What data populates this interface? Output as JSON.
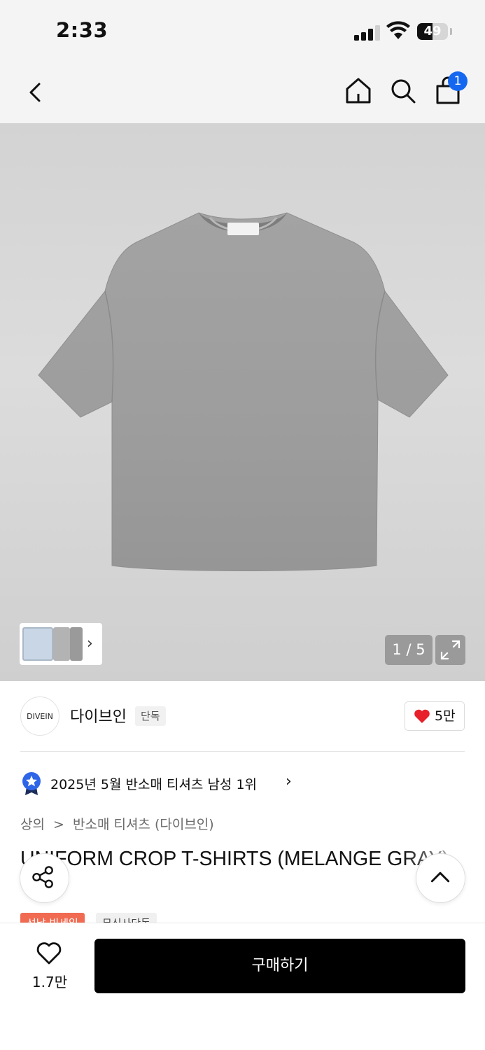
{
  "status_bar": {
    "time": "2:33",
    "battery_level": "49"
  },
  "nav": {
    "cart_count": "1"
  },
  "gallery": {
    "counter": "1 / 5",
    "current_index": 1,
    "total_images": 5,
    "product_color": "#9c9c9c"
  },
  "brand": {
    "logo_text": "DIVEIN",
    "name": "다이브인",
    "tag": "단독",
    "likes": "5만"
  },
  "ranking": {
    "text": "2025년 5월 반소매 티셔츠 남성 1위"
  },
  "breadcrumb": {
    "category": "상의",
    "separator": ">",
    "subcategory": "반소매 티셔츠 (다이브인)"
  },
  "product": {
    "title": "UNIFORM CROP T-SHIRTS (MELANGE GRAY)"
  },
  "tags": {
    "sale": "선날 빅세일",
    "exclusive": "무신사단독"
  },
  "bottom_bar": {
    "wish_count": "1.7만",
    "buy_label": "구매하기"
  },
  "colors": {
    "accent_blue": "#1468f0",
    "heart_red": "#e8202a",
    "sale_orange": "#f06b52",
    "buy_black": "#000000"
  }
}
